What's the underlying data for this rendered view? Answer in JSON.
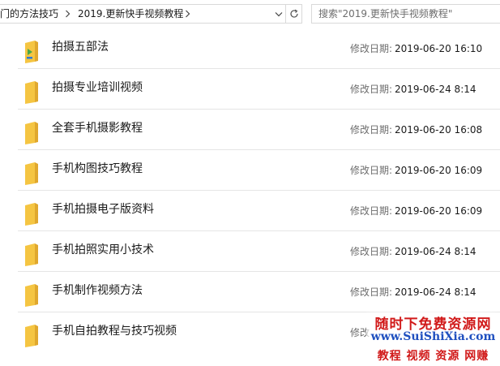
{
  "breadcrumb": {
    "items": [
      "门的方法技巧",
      "2019.更新快手视频教程"
    ]
  },
  "search": {
    "placeholder": "搜索\"2019.更新快手视频教程\""
  },
  "files": [
    {
      "name": "拍摄五部法",
      "modified_label": "修改日期:",
      "modified": "2019-06-20 16:10",
      "icon": "media-folder-icon"
    },
    {
      "name": "拍摄专业培训视频",
      "modified_label": "修改日期:",
      "modified": "2019-06-24 8:14",
      "icon": "folder-icon"
    },
    {
      "name": "全套手机摄影教程",
      "modified_label": "修改日期:",
      "modified": "2019-06-20 16:08",
      "icon": "folder-icon"
    },
    {
      "name": "手机构图技巧教程",
      "modified_label": "修改日期:",
      "modified": "2019-06-20 16:09",
      "icon": "folder-icon"
    },
    {
      "name": "手机拍摄电子版资料",
      "modified_label": "修改日期:",
      "modified": "2019-06-20 16:09",
      "icon": "folder-icon"
    },
    {
      "name": "手机拍照实用小技术",
      "modified_label": "修改日期:",
      "modified": "2019-06-24 8:14",
      "icon": "folder-icon"
    },
    {
      "name": "手机制作视频方法",
      "modified_label": "修改日期:",
      "modified": "2019-06-24 8:14",
      "icon": "folder-icon"
    },
    {
      "name": "手机自拍教程与技巧视频",
      "modified_label": "修改",
      "modified": "",
      "icon": "folder-icon"
    }
  ],
  "watermark": {
    "line1": "随时下免费资源网",
    "line2": "www.SuiShiXia.com",
    "line3": "教程 视频 资源 网赚"
  },
  "colors": {
    "folder": "#f5c542",
    "folder_dark": "#e0a82e",
    "media_green": "#4aa84a",
    "media_blue": "#2b7bd6",
    "watermark_red": "#d11a1a",
    "watermark_blue": "#1f4fbf"
  }
}
